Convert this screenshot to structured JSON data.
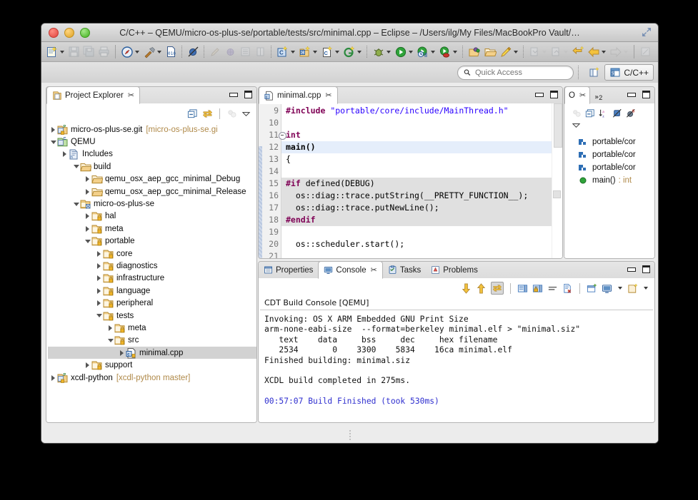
{
  "window": {
    "title": "C/C++ – QEMU/micro-os-plus-se/portable/tests/src/minimal.cpp – Eclipse – /Users/ilg/My Files/MacBookPro Vault/…",
    "traffic_lights": [
      "close",
      "minimize",
      "zoom"
    ],
    "expand_icon": "expand-diagonal-icon"
  },
  "toolbar": {
    "groups": [
      {
        "items": [
          {
            "name": "new-wizard",
            "icon": "new-file-icon",
            "menu": true,
            "enabled": true
          },
          {
            "name": "save",
            "icon": "save-icon",
            "menu": false,
            "enabled": false
          },
          {
            "name": "save-all",
            "icon": "save-all-icon",
            "menu": false,
            "enabled": false
          },
          {
            "name": "print",
            "icon": "print-icon",
            "menu": false,
            "enabled": false
          }
        ]
      },
      {
        "items": [
          {
            "name": "build-all",
            "icon": "compass-icon",
            "menu": true,
            "enabled": true
          },
          {
            "name": "build",
            "icon": "hammer-icon",
            "menu": true,
            "enabled": true
          },
          {
            "name": "open-hex",
            "icon": "binary-file-icon",
            "menu": false,
            "enabled": true
          },
          {
            "name": "toggle-breakpoint",
            "icon": "breakpoint-off-icon",
            "menu": false,
            "enabled": true
          }
        ]
      },
      {
        "items": [
          {
            "name": "search",
            "icon": "pencil-icon",
            "menu": false,
            "enabled": false
          },
          {
            "name": "search-globe",
            "icon": "globe-icon",
            "menu": false,
            "enabled": false
          },
          {
            "name": "toggle-mark",
            "icon": "list-icon",
            "menu": false,
            "enabled": false
          },
          {
            "name": "toggle-block",
            "icon": "table-icon",
            "menu": false,
            "enabled": false
          }
        ]
      },
      {
        "items": [
          {
            "name": "new-cpp-project",
            "icon": "new-cpp-project-icon",
            "menu": true,
            "enabled": true
          },
          {
            "name": "new-cpp-class",
            "icon": "new-cpp-class-icon",
            "menu": true,
            "enabled": true
          },
          {
            "name": "new-cpp-file",
            "icon": "new-cpp-file-icon",
            "menu": true,
            "enabled": true
          },
          {
            "name": "new-git-repo",
            "icon": "git-icon",
            "menu": true,
            "enabled": true
          }
        ]
      },
      {
        "items": [
          {
            "name": "debug",
            "icon": "bug-icon",
            "menu": true,
            "enabled": true
          },
          {
            "name": "run",
            "icon": "run-icon",
            "menu": true,
            "enabled": true
          },
          {
            "name": "run-history",
            "icon": "run-history-icon",
            "menu": true,
            "enabled": true
          },
          {
            "name": "external-tools",
            "icon": "external-tools-icon",
            "menu": true,
            "enabled": true
          }
        ]
      },
      {
        "items": [
          {
            "name": "open-type",
            "icon": "open-type-icon",
            "menu": false,
            "enabled": true
          },
          {
            "name": "open-resource",
            "icon": "open-folder-icon",
            "menu": false,
            "enabled": true
          },
          {
            "name": "annotate",
            "icon": "marker-pen-icon",
            "menu": true,
            "enabled": true
          }
        ]
      },
      {
        "items": [
          {
            "name": "next-annotation",
            "icon": "next-annotation-icon",
            "menu": true,
            "enabled": false
          },
          {
            "name": "prev-annotation",
            "icon": "prev-annotation-icon",
            "menu": true,
            "enabled": false
          },
          {
            "name": "last-edit-location",
            "icon": "last-edit-icon",
            "menu": false,
            "enabled": true
          },
          {
            "name": "back",
            "icon": "back-arrow-icon",
            "menu": true,
            "enabled": true
          },
          {
            "name": "forward",
            "icon": "forward-arrow-icon",
            "menu": true,
            "enabled": false
          }
        ]
      },
      {
        "items": [
          {
            "name": "pin-editor",
            "icon": "pin-editor-icon",
            "menu": false,
            "enabled": false
          }
        ]
      }
    ]
  },
  "toolbar2": {
    "quick_access_placeholder": "Quick Access",
    "quick_access_value": "",
    "search_icon": "search-icon",
    "open_perspective_icon": "open-perspective-icon",
    "perspective_label": "C/C++",
    "perspective_icon": "cpp-perspective-icon"
  },
  "project_explorer": {
    "tab_label": "Project Explorer",
    "tab_icon": "project-explorer-icon",
    "toolbar": [
      {
        "name": "collapse-all",
        "icon": "collapse-all-icon",
        "enabled": true
      },
      {
        "name": "link-with-editor",
        "icon": "link-editor-icon",
        "enabled": true
      },
      {
        "name": "focus-on-active-task",
        "icon": "focus-task-icon",
        "enabled": false
      },
      {
        "name": "view-menu",
        "icon": "chevron-down-icon",
        "enabled": true
      }
    ],
    "tree": [
      {
        "indent": 0,
        "state": "collapsed",
        "icon": "project-git-icon",
        "label": "micro-os-plus-se.git",
        "meta": "[micro-os-plus-se.gi",
        "selected": false
      },
      {
        "indent": 0,
        "state": "expanded",
        "icon": "project-c-icon",
        "label": "QEMU",
        "meta": "",
        "selected": false
      },
      {
        "indent": 1,
        "state": "collapsed",
        "icon": "includes-icon",
        "label": "Includes",
        "meta": "",
        "selected": false
      },
      {
        "indent": 2,
        "state": "expanded",
        "icon": "folder-open-icon",
        "label": "build",
        "meta": "",
        "selected": false
      },
      {
        "indent": 3,
        "state": "collapsed",
        "icon": "folder-open-icon",
        "label": "qemu_osx_aep_gcc_minimal_Debug",
        "meta": "",
        "selected": false
      },
      {
        "indent": 3,
        "state": "collapsed",
        "icon": "folder-open-icon",
        "label": "qemu_osx_aep_gcc_minimal_Release",
        "meta": "",
        "selected": false
      },
      {
        "indent": 2,
        "state": "expanded",
        "icon": "folder-link-icon",
        "label": "micro-os-plus-se",
        "meta": "",
        "selected": false
      },
      {
        "indent": 3,
        "state": "collapsed",
        "icon": "folder-src-icon",
        "label": "hal",
        "meta": "",
        "selected": false
      },
      {
        "indent": 3,
        "state": "collapsed",
        "icon": "folder-src-icon",
        "label": "meta",
        "meta": "",
        "selected": false
      },
      {
        "indent": 3,
        "state": "expanded",
        "icon": "folder-src-icon",
        "label": "portable",
        "meta": "",
        "selected": false
      },
      {
        "indent": 4,
        "state": "collapsed",
        "icon": "folder-src-icon",
        "label": "core",
        "meta": "",
        "selected": false
      },
      {
        "indent": 4,
        "state": "collapsed",
        "icon": "folder-src-icon",
        "label": "diagnostics",
        "meta": "",
        "selected": false
      },
      {
        "indent": 4,
        "state": "collapsed",
        "icon": "folder-src-icon",
        "label": "infrastructure",
        "meta": "",
        "selected": false
      },
      {
        "indent": 4,
        "state": "collapsed",
        "icon": "folder-src-icon",
        "label": "language",
        "meta": "",
        "selected": false
      },
      {
        "indent": 4,
        "state": "collapsed",
        "icon": "folder-src-icon",
        "label": "peripheral",
        "meta": "",
        "selected": false
      },
      {
        "indent": 4,
        "state": "expanded",
        "icon": "folder-src-icon",
        "label": "tests",
        "meta": "",
        "selected": false
      },
      {
        "indent": 5,
        "state": "collapsed",
        "icon": "folder-src-icon",
        "label": "meta",
        "meta": "",
        "selected": false
      },
      {
        "indent": 5,
        "state": "expanded",
        "icon": "folder-src-icon",
        "label": "src",
        "meta": "",
        "selected": false
      },
      {
        "indent": 6,
        "state": "collapsed",
        "icon": "cpp-file-icon",
        "label": "minimal.cpp",
        "meta": "",
        "selected": true
      },
      {
        "indent": 3,
        "state": "collapsed",
        "icon": "folder-src-icon",
        "label": "support",
        "meta": "",
        "selected": false
      },
      {
        "indent": 0,
        "state": "collapsed",
        "icon": "project-git-icon",
        "label": "xcdl-python",
        "meta": "[xcdl-python master]",
        "selected": false
      }
    ]
  },
  "editor": {
    "tab_label": "minimal.cpp",
    "tab_icon": "cpp-file-icon",
    "lines": [
      {
        "num": "9",
        "fold": false,
        "hl": "none",
        "tokens": [
          {
            "t": "#include ",
            "c": "k-pp"
          },
          {
            "t": "\"portable/core/include/MainThread.h\"",
            "c": "k-str"
          }
        ]
      },
      {
        "num": "10",
        "fold": false,
        "hl": "none",
        "tokens": []
      },
      {
        "num": "11",
        "fold": true,
        "hl": "none",
        "tokens": [
          {
            "t": "int",
            "c": "k-kw"
          }
        ]
      },
      {
        "num": "12",
        "fold": false,
        "hl": "cur",
        "tokens": [
          {
            "t": "main()",
            "c": "k-fn"
          }
        ]
      },
      {
        "num": "13",
        "fold": false,
        "hl": "none",
        "tokens": [
          {
            "t": "{",
            "c": "k-pl"
          }
        ]
      },
      {
        "num": "14",
        "fold": false,
        "hl": "none",
        "tokens": []
      },
      {
        "num": "15",
        "fold": false,
        "hl": "block",
        "tokens": [
          {
            "t": "#if",
            "c": "k-pp"
          },
          {
            "t": " defined(DEBUG)",
            "c": "k-pl"
          }
        ]
      },
      {
        "num": "16",
        "fold": false,
        "hl": "block",
        "tokens": [
          {
            "t": "  os::diag::trace.putString(__PRETTY_FUNCTION__);",
            "c": "k-pl"
          }
        ]
      },
      {
        "num": "17",
        "fold": false,
        "hl": "block",
        "tokens": [
          {
            "t": "  os::diag::trace.putNewLine();",
            "c": "k-pl"
          }
        ]
      },
      {
        "num": "18",
        "fold": false,
        "hl": "block",
        "tokens": [
          {
            "t": "#endif",
            "c": "k-pp"
          }
        ]
      },
      {
        "num": "19",
        "fold": false,
        "hl": "none",
        "tokens": []
      },
      {
        "num": "20",
        "fold": false,
        "hl": "none",
        "tokens": [
          {
            "t": "  os::scheduler.start();",
            "c": "k-pl"
          }
        ]
      },
      {
        "num": "21",
        "fold": false,
        "hl": "none",
        "tokens": []
      }
    ]
  },
  "outline": {
    "tab_label": "O",
    "tab_icon": "outline-icon",
    "overflow_label": "2",
    "toolbar": [
      {
        "name": "focus-on-active-task",
        "icon": "focus-task-icon",
        "enabled": false
      },
      {
        "name": "collapse-all",
        "icon": "collapse-all-icon",
        "enabled": true
      },
      {
        "name": "sort",
        "icon": "sort-az-icon",
        "enabled": true
      },
      {
        "name": "hide-fields",
        "icon": "hide-fields-icon",
        "enabled": true
      },
      {
        "name": "hide-static",
        "icon": "hide-static-icon",
        "enabled": true
      },
      {
        "name": "view-menu",
        "icon": "chevron-down-icon",
        "enabled": true
      }
    ],
    "items": [
      {
        "icon": "include-icon",
        "label": "portable/cor",
        "ret": ""
      },
      {
        "icon": "include-icon",
        "label": "portable/cor",
        "ret": ""
      },
      {
        "icon": "include-icon",
        "label": "portable/cor",
        "ret": ""
      },
      {
        "icon": "method-public-icon",
        "label": "main()",
        "ret": ": int"
      }
    ]
  },
  "bottom_panel": {
    "tabs": [
      {
        "label": "Problems",
        "icon": "problems-icon",
        "active": false
      },
      {
        "label": "Tasks",
        "icon": "tasks-icon",
        "active": false
      },
      {
        "label": "Console",
        "icon": "console-icon",
        "active": true
      },
      {
        "label": "Properties",
        "icon": "properties-icon",
        "active": false
      }
    ],
    "toolbar": [
      {
        "name": "scroll-lock-down",
        "icon": "arrow-down-icon",
        "enabled": true,
        "toggled": false
      },
      {
        "name": "scroll-lock-up",
        "icon": "arrow-up-icon",
        "enabled": true,
        "toggled": false
      },
      {
        "name": "pin-console",
        "icon": "pin-console-icon",
        "enabled": true,
        "toggled": true
      },
      {
        "name": "scroll-lock",
        "icon": "scroll-lock-icon",
        "enabled": false,
        "toggled": false
      },
      {
        "name": "lock-console",
        "icon": "lock-console-icon",
        "enabled": false,
        "toggled": false
      },
      {
        "name": "word-wrap",
        "icon": "word-wrap-icon",
        "enabled": true,
        "toggled": false
      },
      {
        "name": "clear-console",
        "icon": "clear-console-icon",
        "enabled": true,
        "toggled": false
      },
      {
        "name": "new-console-view",
        "icon": "new-console-view-icon",
        "enabled": true,
        "toggled": false
      },
      {
        "name": "display-selected-console",
        "icon": "display-console-icon",
        "enabled": true,
        "toggled": false
      },
      {
        "name": "open-console",
        "icon": "open-console-icon",
        "enabled": true,
        "toggled": false
      }
    ],
    "console_header": "CDT Build Console [QEMU]",
    "console_lines": [
      {
        "text": "Invoking: OS X ARM Embedded GNU Print Size",
        "color": "black"
      },
      {
        "text": "arm-none-eabi-size  --format=berkeley minimal.elf > \"minimal.siz\"",
        "color": "black"
      },
      {
        "text": "   text    data     bss     dec     hex filename",
        "color": "black"
      },
      {
        "text": "   2534       0    3300    5834    16ca minimal.elf",
        "color": "black"
      },
      {
        "text": "Finished building: minimal.siz",
        "color": "black"
      },
      {
        "text": "",
        "color": "black"
      },
      {
        "text": "XCDL build completed in 275ms.",
        "color": "black"
      },
      {
        "text": "",
        "color": "black"
      },
      {
        "text": "00:57:07 Build Finished (took 530ms)",
        "color": "blue"
      }
    ]
  },
  "colors": {
    "selection": "#d2d2d2",
    "current_line": "#e5eefb",
    "block_highlight": "#e0e0e0",
    "preprocessor": "#7f0055",
    "string": "#2a00ff",
    "console_blue": "#2e2ecf",
    "git_meta": "#b08a4a"
  }
}
